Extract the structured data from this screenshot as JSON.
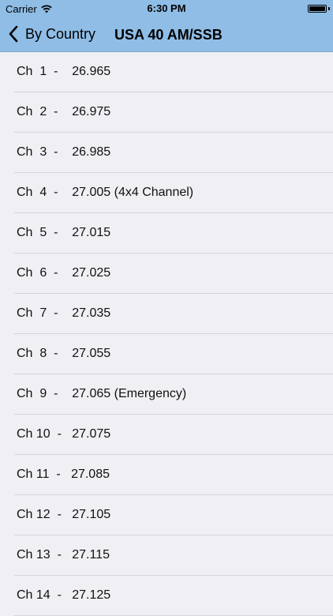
{
  "status_bar": {
    "carrier": "Carrier",
    "time": "6:30 PM"
  },
  "nav": {
    "back_label": "By Country",
    "title": "USA 40 AM/SSB"
  },
  "channels": [
    "Ch  1  -    26.965",
    "Ch  2  -    26.975",
    "Ch  3  -    26.985",
    "Ch  4  -    27.005 (4x4 Channel)",
    "Ch  5  -    27.015",
    "Ch  6  -    27.025",
    "Ch  7  -    27.035",
    "Ch  8  -    27.055",
    "Ch  9  -    27.065 (Emergency)",
    "Ch 10  -   27.075",
    "Ch 11  -   27.085",
    "Ch 12  -   27.105",
    "Ch 13  -   27.115",
    "Ch 14  -   27.125"
  ],
  "colors": {
    "header": "#8fbde6",
    "background": "#efeff4",
    "separator": "#d6d6da"
  },
  "icons": {
    "back": "chevron-left-icon",
    "wifi": "wifi-icon",
    "battery": "battery-icon"
  }
}
